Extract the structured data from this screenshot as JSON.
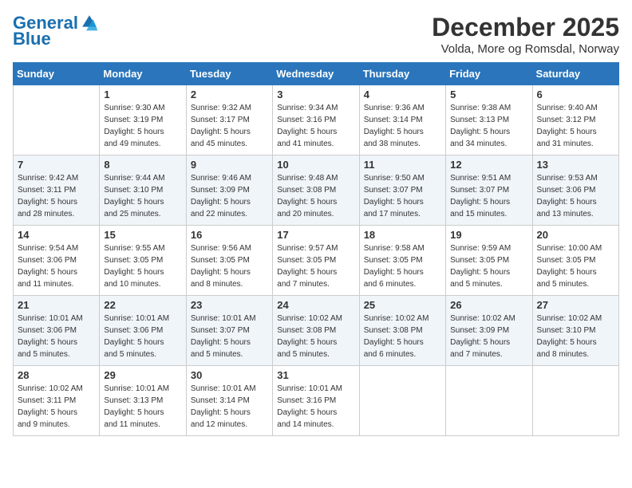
{
  "logo": {
    "text_general": "General",
    "text_blue": "Blue"
  },
  "title": "December 2025",
  "location": "Volda, More og Romsdal, Norway",
  "days_of_week": [
    "Sunday",
    "Monday",
    "Tuesday",
    "Wednesday",
    "Thursday",
    "Friday",
    "Saturday"
  ],
  "weeks": [
    [
      {
        "day": "",
        "info": ""
      },
      {
        "day": "1",
        "info": "Sunrise: 9:30 AM\nSunset: 3:19 PM\nDaylight: 5 hours\nand 49 minutes."
      },
      {
        "day": "2",
        "info": "Sunrise: 9:32 AM\nSunset: 3:17 PM\nDaylight: 5 hours\nand 45 minutes."
      },
      {
        "day": "3",
        "info": "Sunrise: 9:34 AM\nSunset: 3:16 PM\nDaylight: 5 hours\nand 41 minutes."
      },
      {
        "day": "4",
        "info": "Sunrise: 9:36 AM\nSunset: 3:14 PM\nDaylight: 5 hours\nand 38 minutes."
      },
      {
        "day": "5",
        "info": "Sunrise: 9:38 AM\nSunset: 3:13 PM\nDaylight: 5 hours\nand 34 minutes."
      },
      {
        "day": "6",
        "info": "Sunrise: 9:40 AM\nSunset: 3:12 PM\nDaylight: 5 hours\nand 31 minutes."
      }
    ],
    [
      {
        "day": "7",
        "info": "Sunrise: 9:42 AM\nSunset: 3:11 PM\nDaylight: 5 hours\nand 28 minutes."
      },
      {
        "day": "8",
        "info": "Sunrise: 9:44 AM\nSunset: 3:10 PM\nDaylight: 5 hours\nand 25 minutes."
      },
      {
        "day": "9",
        "info": "Sunrise: 9:46 AM\nSunset: 3:09 PM\nDaylight: 5 hours\nand 22 minutes."
      },
      {
        "day": "10",
        "info": "Sunrise: 9:48 AM\nSunset: 3:08 PM\nDaylight: 5 hours\nand 20 minutes."
      },
      {
        "day": "11",
        "info": "Sunrise: 9:50 AM\nSunset: 3:07 PM\nDaylight: 5 hours\nand 17 minutes."
      },
      {
        "day": "12",
        "info": "Sunrise: 9:51 AM\nSunset: 3:07 PM\nDaylight: 5 hours\nand 15 minutes."
      },
      {
        "day": "13",
        "info": "Sunrise: 9:53 AM\nSunset: 3:06 PM\nDaylight: 5 hours\nand 13 minutes."
      }
    ],
    [
      {
        "day": "14",
        "info": "Sunrise: 9:54 AM\nSunset: 3:06 PM\nDaylight: 5 hours\nand 11 minutes."
      },
      {
        "day": "15",
        "info": "Sunrise: 9:55 AM\nSunset: 3:05 PM\nDaylight: 5 hours\nand 10 minutes."
      },
      {
        "day": "16",
        "info": "Sunrise: 9:56 AM\nSunset: 3:05 PM\nDaylight: 5 hours\nand 8 minutes."
      },
      {
        "day": "17",
        "info": "Sunrise: 9:57 AM\nSunset: 3:05 PM\nDaylight: 5 hours\nand 7 minutes."
      },
      {
        "day": "18",
        "info": "Sunrise: 9:58 AM\nSunset: 3:05 PM\nDaylight: 5 hours\nand 6 minutes."
      },
      {
        "day": "19",
        "info": "Sunrise: 9:59 AM\nSunset: 3:05 PM\nDaylight: 5 hours\nand 5 minutes."
      },
      {
        "day": "20",
        "info": "Sunrise: 10:00 AM\nSunset: 3:05 PM\nDaylight: 5 hours\nand 5 minutes."
      }
    ],
    [
      {
        "day": "21",
        "info": "Sunrise: 10:01 AM\nSunset: 3:06 PM\nDaylight: 5 hours\nand 5 minutes."
      },
      {
        "day": "22",
        "info": "Sunrise: 10:01 AM\nSunset: 3:06 PM\nDaylight: 5 hours\nand 5 minutes."
      },
      {
        "day": "23",
        "info": "Sunrise: 10:01 AM\nSunset: 3:07 PM\nDaylight: 5 hours\nand 5 minutes."
      },
      {
        "day": "24",
        "info": "Sunrise: 10:02 AM\nSunset: 3:08 PM\nDaylight: 5 hours\nand 5 minutes."
      },
      {
        "day": "25",
        "info": "Sunrise: 10:02 AM\nSunset: 3:08 PM\nDaylight: 5 hours\nand 6 minutes."
      },
      {
        "day": "26",
        "info": "Sunrise: 10:02 AM\nSunset: 3:09 PM\nDaylight: 5 hours\nand 7 minutes."
      },
      {
        "day": "27",
        "info": "Sunrise: 10:02 AM\nSunset: 3:10 PM\nDaylight: 5 hours\nand 8 minutes."
      }
    ],
    [
      {
        "day": "28",
        "info": "Sunrise: 10:02 AM\nSunset: 3:11 PM\nDaylight: 5 hours\nand 9 minutes."
      },
      {
        "day": "29",
        "info": "Sunrise: 10:01 AM\nSunset: 3:13 PM\nDaylight: 5 hours\nand 11 minutes."
      },
      {
        "day": "30",
        "info": "Sunrise: 10:01 AM\nSunset: 3:14 PM\nDaylight: 5 hours\nand 12 minutes."
      },
      {
        "day": "31",
        "info": "Sunrise: 10:01 AM\nSunset: 3:16 PM\nDaylight: 5 hours\nand 14 minutes."
      },
      {
        "day": "",
        "info": ""
      },
      {
        "day": "",
        "info": ""
      },
      {
        "day": "",
        "info": ""
      }
    ]
  ]
}
